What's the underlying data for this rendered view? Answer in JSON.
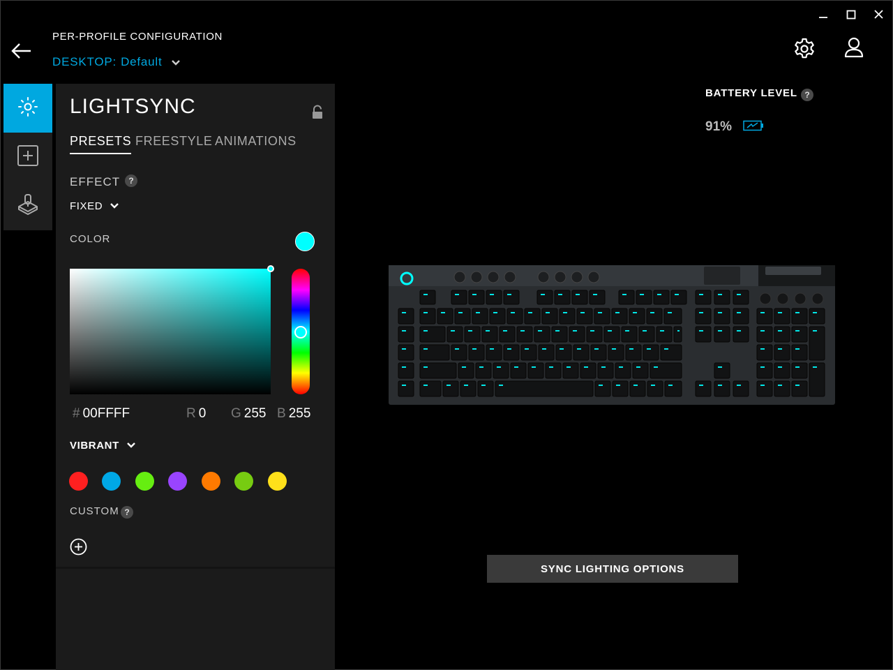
{
  "window": {
    "minimize_icon": "minimize-icon",
    "maximize_icon": "maximize-icon",
    "close_icon": "close-icon"
  },
  "header": {
    "title": "PER-PROFILE CONFIGURATION",
    "profile_prefix": "DESKTOP:",
    "profile_name": "Default",
    "back_icon": "arrow-left-icon",
    "settings_icon": "gear-icon",
    "account_icon": "user-icon"
  },
  "rail": {
    "items": [
      {
        "name": "lightsync",
        "icon": "sun-icon",
        "active": true
      },
      {
        "name": "assignments",
        "icon": "plus-square-icon",
        "active": false
      },
      {
        "name": "game-mode",
        "icon": "joystick-icon",
        "active": false
      }
    ]
  },
  "panel": {
    "title": "LIGHTSYNC",
    "tabs": [
      {
        "label": "PRESETS",
        "active": true
      },
      {
        "label": "FREESTYLE",
        "active": false
      },
      {
        "label": "ANIMATIONS",
        "active": false
      }
    ],
    "effect_label": "EFFECT",
    "help": "?",
    "effect_value": "FIXED",
    "color_label": "COLOR",
    "current_color": "#00FFFF",
    "hex_symbol": "#",
    "hex_value": "00FFFF",
    "r_label": "R",
    "r_value": "0",
    "g_label": "G",
    "g_value": "255",
    "b_label": "B",
    "b_value": "255",
    "palette_label": "VIBRANT",
    "swatches": [
      "#ff2020",
      "#00a8e6",
      "#66ee11",
      "#9944ff",
      "#ff7a00",
      "#77cc11",
      "#ffe01a"
    ],
    "custom_label": "CUSTOM"
  },
  "battery": {
    "label": "BATTERY LEVEL",
    "help": "?",
    "value": "91%"
  },
  "sync_button": "SYNC LIGHTING OPTIONS",
  "colors": {
    "accent": "#00a8e0",
    "panel_bg": "#1b1b1b",
    "key_glow": "#00ffff"
  }
}
